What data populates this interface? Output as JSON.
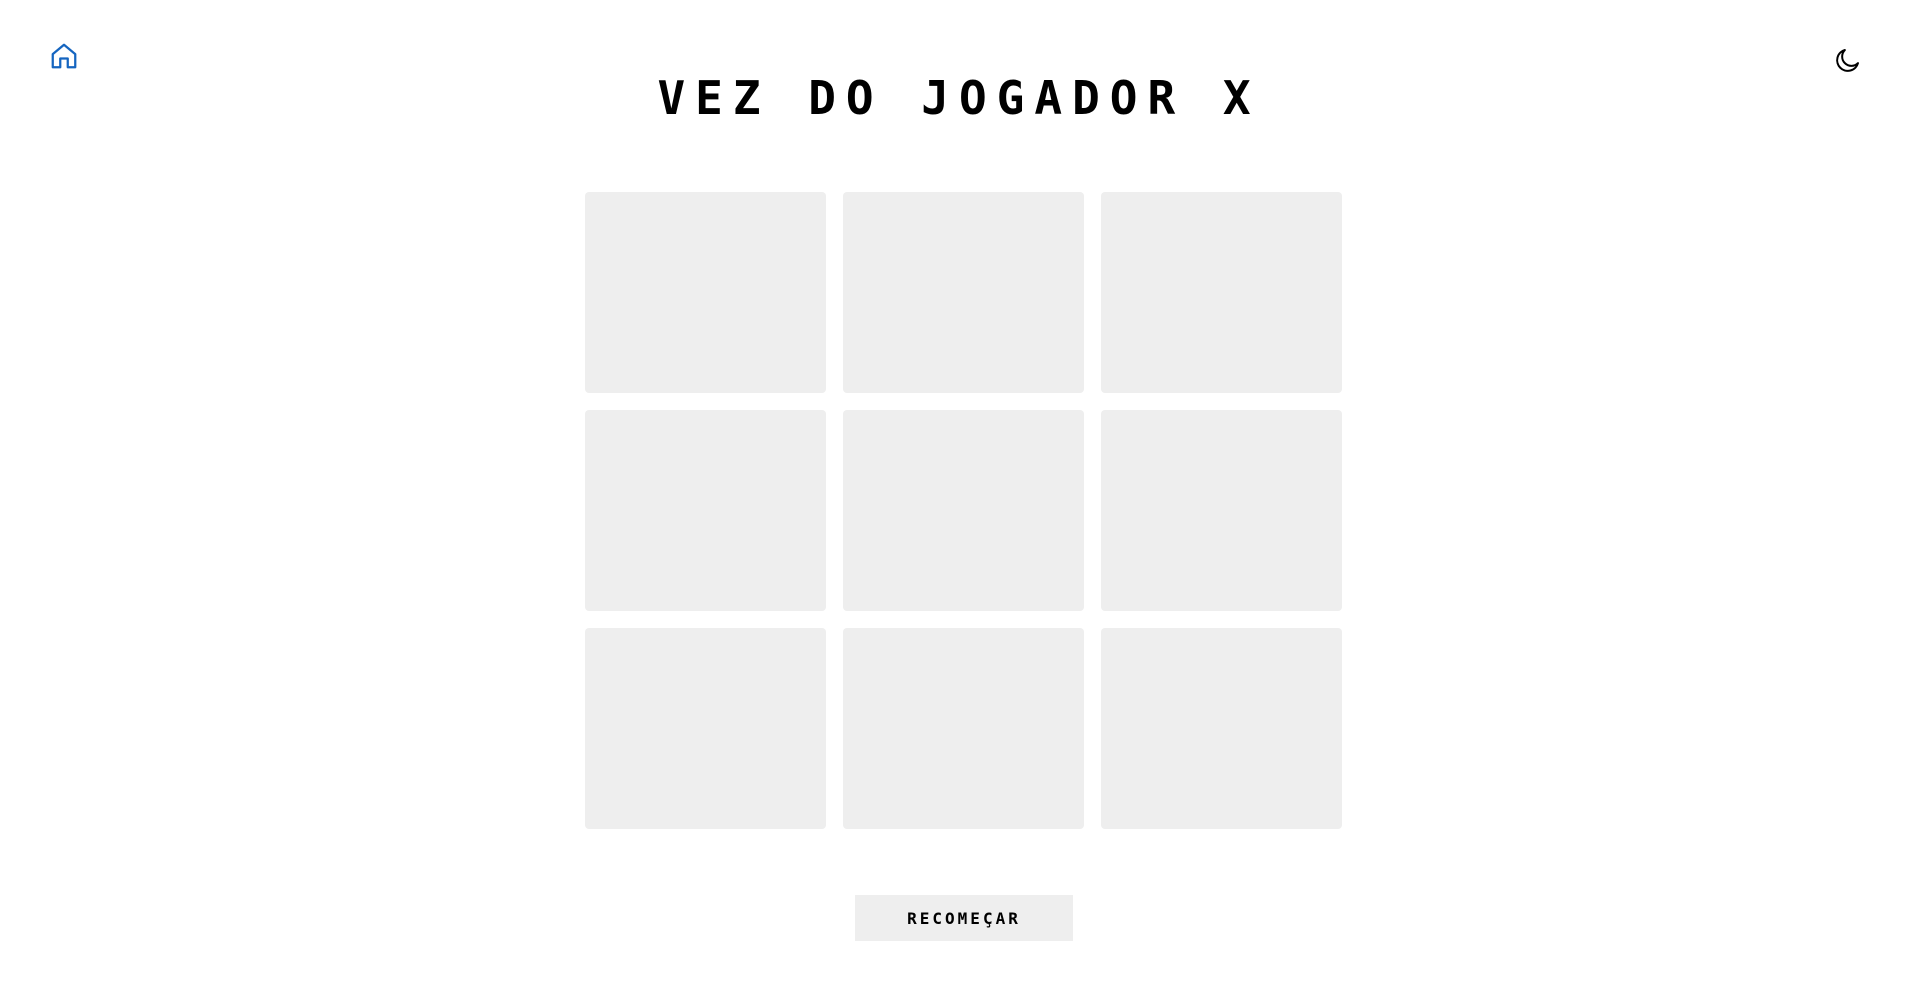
{
  "header": {
    "home_icon": "home-icon",
    "theme_icon": "moon-icon",
    "title": "VEZ DO JOGADOR X"
  },
  "board": {
    "cells": [
      "",
      "",
      "",
      "",
      "",
      "",
      "",
      "",
      ""
    ]
  },
  "controls": {
    "restart_label": "RECOMEÇAR"
  },
  "colors": {
    "home_icon": "#1565c0",
    "cell_bg": "#eeeeee",
    "text": "#000000",
    "background": "#ffffff"
  }
}
